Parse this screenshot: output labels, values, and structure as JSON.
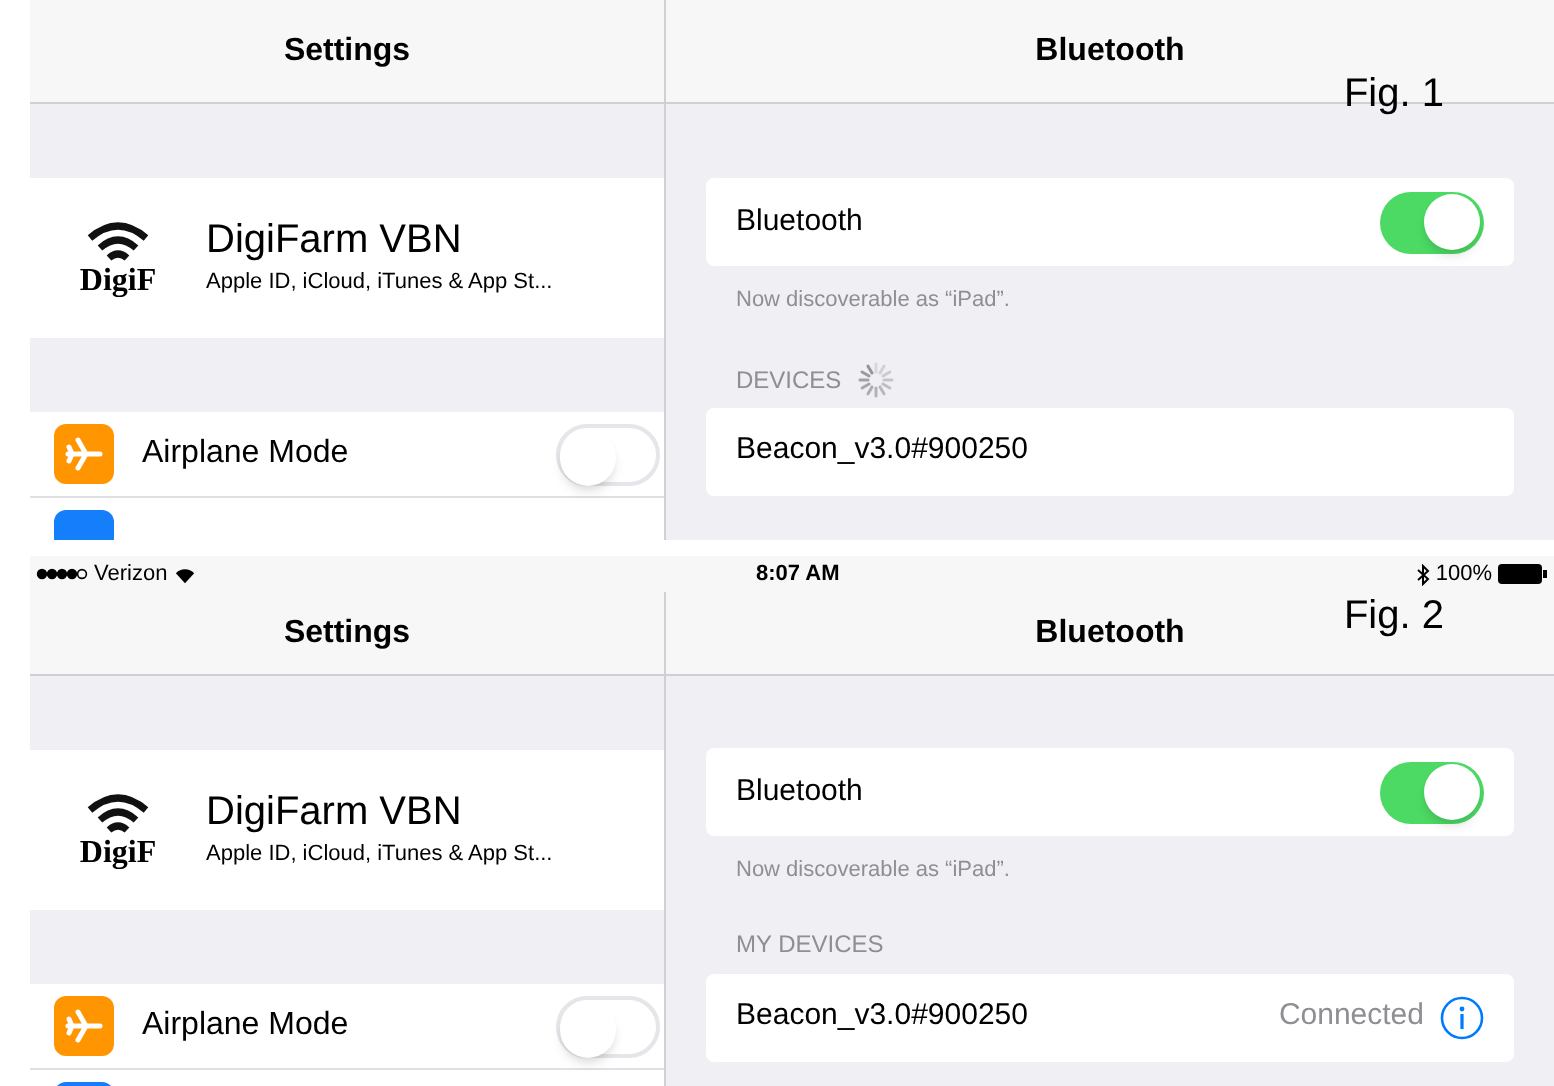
{
  "figures": [
    {
      "caption": "Fig. 1",
      "settings_title": "Settings",
      "detail_title": "Bluetooth",
      "account": {
        "logo_text": "DigiF",
        "name": "DigiFarm VBN",
        "subtitle": "Apple ID, iCloud, iTunes & App St..."
      },
      "airplane": {
        "label": "Airplane Mode",
        "on": false
      },
      "bluetooth": {
        "label": "Bluetooth",
        "on": true
      },
      "note": "Now discoverable as “iPad”.",
      "section": {
        "label": "DEVICES",
        "searching": true
      },
      "devices": [
        {
          "name": "Beacon_v3.0#900250",
          "info": false
        }
      ]
    },
    {
      "caption": "Fig. 2",
      "status_bar": {
        "carrier": "Verizon",
        "time": "8:07 AM",
        "battery": "100%"
      },
      "settings_title": "Settings",
      "detail_title": "Bluetooth",
      "account": {
        "logo_text": "DigiF",
        "name": "DigiFarm VBN",
        "subtitle": "Apple ID, iCloud, iTunes & App St..."
      },
      "airplane": {
        "label": "Airplane Mode",
        "on": false
      },
      "bluetooth": {
        "label": "Bluetooth",
        "on": true
      },
      "note": "Now discoverable as “iPad”.",
      "section": {
        "label": "MY DEVICES"
      },
      "devices": [
        {
          "name": "Beacon_v3.0#900250",
          "status": "Connected",
          "info": true
        }
      ]
    }
  ]
}
